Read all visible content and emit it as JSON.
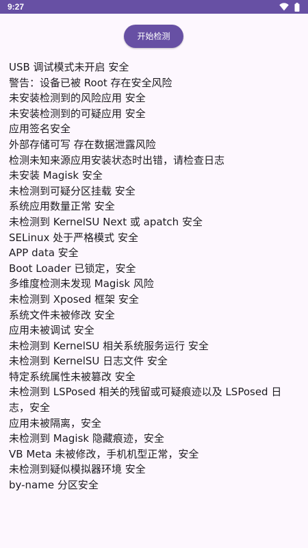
{
  "status_bar": {
    "time": "9:27",
    "icons": [
      "wifi-icon",
      "battery-icon"
    ]
  },
  "actions": {
    "start_label": "开始检测"
  },
  "results": [
    "USB 调试模式未开启 安全",
    "警告：设备已被 Root 存在安全风险",
    "未安装检测到的风险应用 安全",
    "未安装检测到的可疑应用 安全",
    "应用签名安全",
    "外部存储可写 存在数据泄露风险",
    "检测未知来源应用安装状态时出错，请检查日志",
    "未安装 Magisk 安全",
    "未检测到可疑分区挂载 安全",
    "系统应用数量正常 安全",
    "未检测到 KernelSU Next 或 apatch 安全",
    "SELinux 处于严格模式 安全",
    "APP data 安全",
    "Boot Loader 已锁定，安全",
    "多维度检测未发现 Magisk 风险",
    "未检测到 Xposed 框架 安全",
    "系统文件未被修改 安全",
    "应用未被调试 安全",
    "未检测到 KernelSU 相关系统服务运行 安全",
    "未检测到 KernelSU 日志文件 安全",
    "特定系统属性未被篡改 安全",
    "未检测到 LSPosed 相关的残留或可疑痕迹以及 LSPosed 日志，安全",
    "应用未被隔离，安全",
    "未检测到 Magisk 隐藏痕迹，安全",
    "VB Meta 未被修改，手机机型正常，安全",
    "未检测到疑似模拟器环境 安全",
    "by-name 分区安全"
  ],
  "colors": {
    "primary": "#6750a4",
    "background": "#fdf7fe",
    "text": "#1d1b20"
  }
}
